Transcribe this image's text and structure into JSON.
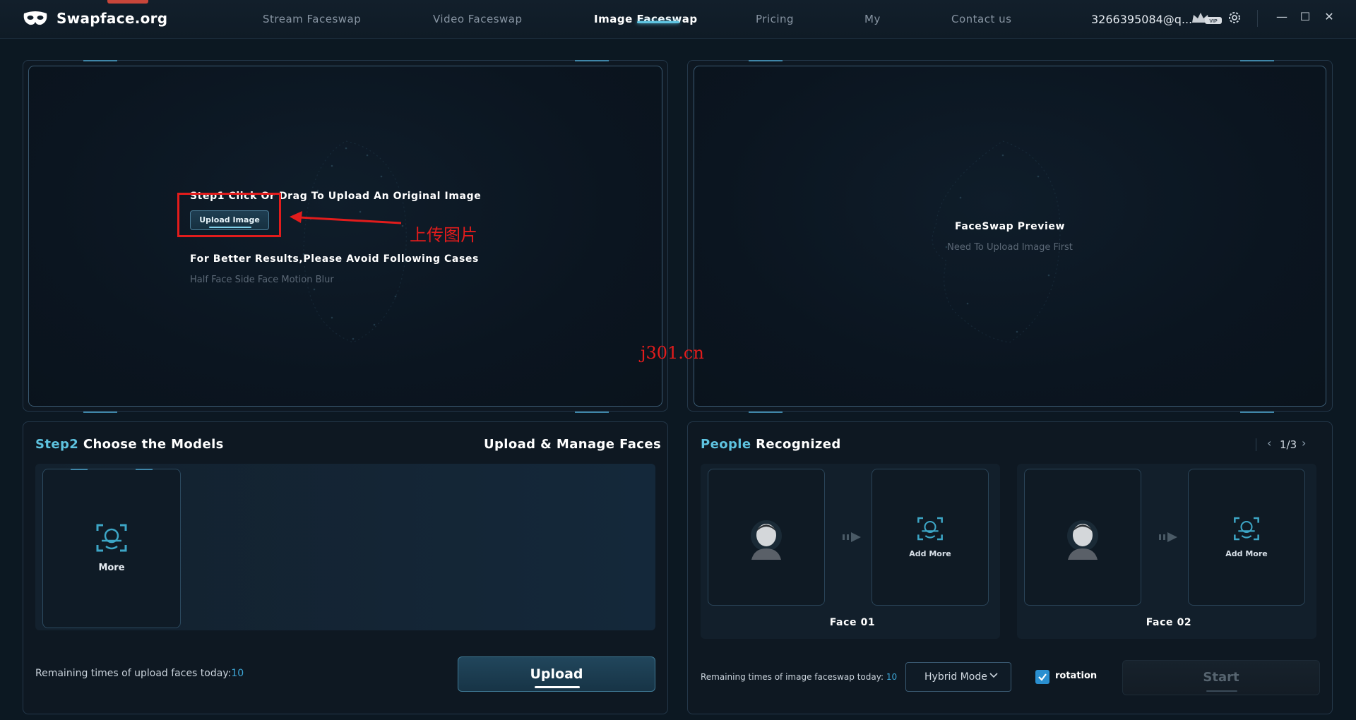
{
  "app": {
    "name": "Swapface.org"
  },
  "nav": {
    "items": [
      {
        "label": "Stream Faceswap",
        "active": false
      },
      {
        "label": "Video Faceswap",
        "active": false
      },
      {
        "label": "Image Faceswap",
        "active": true
      },
      {
        "label": "Pricing",
        "active": false
      },
      {
        "label": "My",
        "active": false
      },
      {
        "label": "Contact us",
        "active": false
      }
    ]
  },
  "account": {
    "email": "3266395084@q...",
    "badge": "VIP"
  },
  "step1": {
    "title": "Step1 Click Or Drag To Upload An Original Image",
    "upload_button": "Upload Image",
    "annotation": "上传图片",
    "better_title": "For Better Results,Please Avoid Following Cases",
    "avoid": "Half Face Side Face Motion Blur"
  },
  "preview": {
    "title": "FaceSwap Preview",
    "subtitle": "Need To Upload Image First"
  },
  "watermark": "j301.cn",
  "step2": {
    "prefix": "Step2",
    "title": "Choose the Models",
    "manage": "Upload & Manage Faces",
    "more_label": "More",
    "remaining_label": "Remaining times of upload faces today:",
    "remaining_value": "10",
    "upload_button": "Upload"
  },
  "people": {
    "prefix": "People",
    "title": "Recognized",
    "pager": "1/3",
    "faces": [
      {
        "label": "Face 01",
        "add_label": "Add More"
      },
      {
        "label": "Face 02",
        "add_label": "Add More"
      }
    ],
    "remaining_label": "Remaining times of image faceswap today:",
    "remaining_value": "10",
    "mode": "Hybrid Mode",
    "rotation_label": "rotation",
    "rotation_checked": true,
    "start_button": "Start"
  },
  "colors": {
    "accent": "#5ec3e0",
    "annotation": "#e21c1c",
    "checkbox": "#2a8fd0"
  }
}
